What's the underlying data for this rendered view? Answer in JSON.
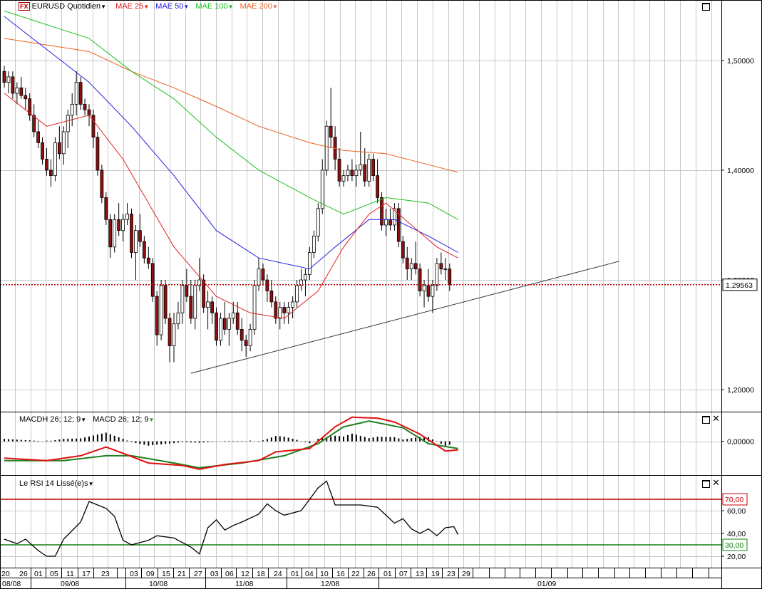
{
  "main_panel": {
    "symbol_badge": "FX",
    "instrument": "EURUSD Quotidien",
    "indicators": [
      {
        "label": "MAE 25",
        "color": "#e02020"
      },
      {
        "label": "MAE 50",
        "color": "#2020e0"
      },
      {
        "label": "MAE 100",
        "color": "#20c020"
      },
      {
        "label": "MAE 200",
        "color": "#f06020"
      }
    ],
    "price_ticks": [
      "1,50000",
      "1,40000",
      "1,30000",
      "1,20000"
    ],
    "current_price": "1,29563"
  },
  "macd_panel": {
    "labels": [
      {
        "label": "MACDH 26; 12; 9"
      },
      {
        "label": "MACD 26; 12; 9",
        "color": "#20a020"
      }
    ],
    "ticks": [
      "0,00000"
    ]
  },
  "rsi_panel": {
    "label": "Le RSI 14 Lissé(e)s",
    "ticks": [
      "60,00",
      "40,00",
      "20,00"
    ],
    "upper_level": "70,00",
    "lower_level": "30,00"
  },
  "date_axis": {
    "days": [
      "20",
      "26",
      "01",
      "05",
      "11",
      "17",
      "23",
      "03",
      "09",
      "15",
      "21",
      "27",
      "03",
      "06",
      "12",
      "18",
      "24",
      "01",
      "04",
      "10",
      "16",
      "22",
      "26",
      "01",
      "07",
      "13",
      "19",
      "23",
      "29"
    ],
    "months": [
      "08/08",
      "09/08",
      "10/08",
      "11/08",
      "12/08",
      "01/09"
    ]
  },
  "colors": {
    "up": "#ffffff",
    "down": "#8b1010",
    "grid": "#c8c8c8",
    "mae25": "#e02020",
    "mae50": "#2020e0",
    "mae100": "#20c020",
    "mae200": "#f06020",
    "macd_line": "#e01010",
    "signal_line": "#208020",
    "rsi_line": "#000000",
    "level_70": "#c00000",
    "level_30": "#108010"
  },
  "chart_data": {
    "type": "candlestick",
    "ylim": [
      1.18,
      1.555
    ],
    "current_price": 1.29563,
    "candles": [
      [
        1.49,
        1.495,
        1.475,
        1.48
      ],
      [
        1.48,
        1.49,
        1.47,
        1.485
      ],
      [
        1.485,
        1.49,
        1.465,
        1.47
      ],
      [
        1.47,
        1.48,
        1.46,
        1.475
      ],
      [
        1.475,
        1.485,
        1.465,
        1.468
      ],
      [
        1.468,
        1.475,
        1.455,
        1.465
      ],
      [
        1.465,
        1.47,
        1.445,
        1.45
      ],
      [
        1.45,
        1.46,
        1.43,
        1.435
      ],
      [
        1.435,
        1.445,
        1.42,
        1.425
      ],
      [
        1.425,
        1.43,
        1.405,
        1.41
      ],
      [
        1.41,
        1.42,
        1.395,
        1.4
      ],
      [
        1.4,
        1.41,
        1.385,
        1.395
      ],
      [
        1.395,
        1.43,
        1.39,
        1.425
      ],
      [
        1.425,
        1.44,
        1.41,
        1.415
      ],
      [
        1.415,
        1.44,
        1.405,
        1.435
      ],
      [
        1.435,
        1.455,
        1.42,
        1.45
      ],
      [
        1.45,
        1.47,
        1.44,
        1.46
      ],
      [
        1.46,
        1.49,
        1.45,
        1.48
      ],
      [
        1.48,
        1.485,
        1.455,
        1.46
      ],
      [
        1.46,
        1.465,
        1.45,
        1.455
      ],
      [
        1.455,
        1.46,
        1.44,
        1.45
      ],
      [
        1.45,
        1.455,
        1.42,
        1.43
      ],
      [
        1.43,
        1.435,
        1.395,
        1.4
      ],
      [
        1.4,
        1.405,
        1.37,
        1.375
      ],
      [
        1.375,
        1.38,
        1.35,
        1.355
      ],
      [
        1.355,
        1.36,
        1.32,
        1.33
      ],
      [
        1.33,
        1.36,
        1.325,
        1.355
      ],
      [
        1.355,
        1.37,
        1.34,
        1.345
      ],
      [
        1.345,
        1.36,
        1.335,
        1.355
      ],
      [
        1.355,
        1.37,
        1.35,
        1.36
      ],
      [
        1.36,
        1.365,
        1.32,
        1.325
      ],
      [
        1.325,
        1.35,
        1.3,
        1.345
      ],
      [
        1.345,
        1.36,
        1.33,
        1.335
      ],
      [
        1.335,
        1.34,
        1.315,
        1.32
      ],
      [
        1.32,
        1.33,
        1.31,
        1.315
      ],
      [
        1.315,
        1.32,
        1.28,
        1.285
      ],
      [
        1.285,
        1.29,
        1.24,
        1.25
      ],
      [
        1.25,
        1.3,
        1.245,
        1.295
      ],
      [
        1.295,
        1.3,
        1.26,
        1.265
      ],
      [
        1.265,
        1.27,
        1.225,
        1.24
      ],
      [
        1.24,
        1.27,
        1.225,
        1.26
      ],
      [
        1.26,
        1.28,
        1.255,
        1.27
      ],
      [
        1.27,
        1.3,
        1.26,
        1.295
      ],
      [
        1.295,
        1.31,
        1.28,
        1.285
      ],
      [
        1.285,
        1.3,
        1.26,
        1.265
      ],
      [
        1.265,
        1.3,
        1.255,
        1.295
      ],
      [
        1.295,
        1.32,
        1.29,
        1.3
      ],
      [
        1.3,
        1.305,
        1.27,
        1.275
      ],
      [
        1.275,
        1.29,
        1.255,
        1.28
      ],
      [
        1.28,
        1.285,
        1.26,
        1.27
      ],
      [
        1.27,
        1.275,
        1.24,
        1.245
      ],
      [
        1.245,
        1.27,
        1.24,
        1.265
      ],
      [
        1.265,
        1.28,
        1.25,
        1.255
      ],
      [
        1.255,
        1.27,
        1.24,
        1.265
      ],
      [
        1.265,
        1.28,
        1.26,
        1.27
      ],
      [
        1.27,
        1.28,
        1.25,
        1.255
      ],
      [
        1.255,
        1.265,
        1.235,
        1.245
      ],
      [
        1.245,
        1.25,
        1.23,
        1.24
      ],
      [
        1.24,
        1.26,
        1.235,
        1.255
      ],
      [
        1.255,
        1.3,
        1.25,
        1.295
      ],
      [
        1.295,
        1.32,
        1.29,
        1.31
      ],
      [
        1.31,
        1.315,
        1.295,
        1.3
      ],
      [
        1.3,
        1.305,
        1.28,
        1.29
      ],
      [
        1.29,
        1.3,
        1.275,
        1.28
      ],
      [
        1.28,
        1.285,
        1.26,
        1.265
      ],
      [
        1.265,
        1.28,
        1.255,
        1.275
      ],
      [
        1.275,
        1.28,
        1.26,
        1.27
      ],
      [
        1.27,
        1.28,
        1.26,
        1.275
      ],
      [
        1.275,
        1.285,
        1.265,
        1.28
      ],
      [
        1.28,
        1.3,
        1.275,
        1.295
      ],
      [
        1.295,
        1.31,
        1.29,
        1.3
      ],
      [
        1.3,
        1.31,
        1.285,
        1.305
      ],
      [
        1.305,
        1.33,
        1.3,
        1.325
      ],
      [
        1.325,
        1.345,
        1.32,
        1.34
      ],
      [
        1.34,
        1.37,
        1.335,
        1.365
      ],
      [
        1.365,
        1.41,
        1.36,
        1.4
      ],
      [
        1.4,
        1.445,
        1.395,
        1.44
      ],
      [
        1.44,
        1.475,
        1.42,
        1.43
      ],
      [
        1.43,
        1.44,
        1.4,
        1.41
      ],
      [
        1.41,
        1.42,
        1.385,
        1.39
      ],
      [
        1.39,
        1.4,
        1.385,
        1.395
      ],
      [
        1.395,
        1.405,
        1.39,
        1.4
      ],
      [
        1.4,
        1.41,
        1.39,
        1.395
      ],
      [
        1.395,
        1.405,
        1.385,
        1.4
      ],
      [
        1.4,
        1.435,
        1.395,
        1.405
      ],
      [
        1.405,
        1.42,
        1.385,
        1.39
      ],
      [
        1.39,
        1.415,
        1.385,
        1.41
      ],
      [
        1.41,
        1.415,
        1.39,
        1.395
      ],
      [
        1.395,
        1.41,
        1.37,
        1.375
      ],
      [
        1.375,
        1.38,
        1.345,
        1.35
      ],
      [
        1.35,
        1.365,
        1.34,
        1.355
      ],
      [
        1.355,
        1.365,
        1.345,
        1.35
      ],
      [
        1.35,
        1.37,
        1.345,
        1.365
      ],
      [
        1.365,
        1.37,
        1.33,
        1.335
      ],
      [
        1.335,
        1.34,
        1.315,
        1.32
      ],
      [
        1.32,
        1.33,
        1.3,
        1.31
      ],
      [
        1.31,
        1.32,
        1.3,
        1.315
      ],
      [
        1.315,
        1.335,
        1.305,
        1.31
      ],
      [
        1.31,
        1.315,
        1.285,
        1.29
      ],
      [
        1.29,
        1.3,
        1.275,
        1.295
      ],
      [
        1.295,
        1.31,
        1.28,
        1.285
      ],
      [
        1.285,
        1.3,
        1.27,
        1.295
      ],
      [
        1.295,
        1.32,
        1.29,
        1.315
      ],
      [
        1.315,
        1.325,
        1.305,
        1.31
      ],
      [
        1.31,
        1.32,
        1.3,
        1.31
      ],
      [
        1.31,
        1.315,
        1.29,
        1.2956
      ]
    ],
    "mae25": [
      [
        0,
        1.47
      ],
      [
        10,
        1.44
      ],
      [
        20,
        1.45
      ],
      [
        28,
        1.41
      ],
      [
        40,
        1.33
      ],
      [
        50,
        1.285
      ],
      [
        58,
        1.27
      ],
      [
        66,
        1.265
      ],
      [
        74,
        1.29
      ],
      [
        80,
        1.33
      ],
      [
        86,
        1.36
      ],
      [
        90,
        1.37
      ],
      [
        96,
        1.35
      ],
      [
        102,
        1.33
      ],
      [
        107,
        1.32
      ]
    ],
    "mae50": [
      [
        0,
        1.54
      ],
      [
        10,
        1.51
      ],
      [
        20,
        1.48
      ],
      [
        30,
        1.44
      ],
      [
        40,
        1.395
      ],
      [
        50,
        1.345
      ],
      [
        60,
        1.32
      ],
      [
        72,
        1.31
      ],
      [
        78,
        1.33
      ],
      [
        86,
        1.355
      ],
      [
        92,
        1.355
      ],
      [
        100,
        1.34
      ],
      [
        107,
        1.325
      ]
    ],
    "mae100": [
      [
        0,
        1.545
      ],
      [
        20,
        1.52
      ],
      [
        30,
        1.49
      ],
      [
        40,
        1.465
      ],
      [
        50,
        1.43
      ],
      [
        60,
        1.4
      ],
      [
        72,
        1.375
      ],
      [
        80,
        1.36
      ],
      [
        90,
        1.375
      ],
      [
        100,
        1.37
      ],
      [
        107,
        1.355
      ]
    ],
    "mae200": [
      [
        0,
        1.52
      ],
      [
        20,
        1.508
      ],
      [
        30,
        1.49
      ],
      [
        40,
        1.475
      ],
      [
        50,
        1.458
      ],
      [
        60,
        1.44
      ],
      [
        72,
        1.425
      ],
      [
        80,
        1.418
      ],
      [
        90,
        1.415
      ],
      [
        100,
        1.405
      ],
      [
        107,
        1.398
      ]
    ],
    "trendline": [
      [
        44,
        1.215
      ],
      [
        145,
        1.317
      ]
    ],
    "macd_ylim": [
      -0.07,
      0.06
    ],
    "macd_line": [
      [
        0,
        -0.035
      ],
      [
        10,
        -0.04
      ],
      [
        18,
        -0.03
      ],
      [
        24,
        -0.012
      ],
      [
        28,
        -0.025
      ],
      [
        34,
        -0.045
      ],
      [
        42,
        -0.05
      ],
      [
        46,
        -0.058
      ],
      [
        52,
        -0.048
      ],
      [
        60,
        -0.04
      ],
      [
        64,
        -0.022
      ],
      [
        72,
        -0.015
      ],
      [
        78,
        0.03
      ],
      [
        82,
        0.05
      ],
      [
        88,
        0.048
      ],
      [
        92,
        0.04
      ],
      [
        98,
        0.015
      ],
      [
        104,
        -0.02
      ],
      [
        107,
        -0.018
      ]
    ],
    "signal_line": [
      [
        0,
        -0.04
      ],
      [
        14,
        -0.04
      ],
      [
        24,
        -0.03
      ],
      [
        30,
        -0.03
      ],
      [
        40,
        -0.045
      ],
      [
        46,
        -0.055
      ],
      [
        56,
        -0.045
      ],
      [
        66,
        -0.03
      ],
      [
        74,
        -0.005
      ],
      [
        80,
        0.03
      ],
      [
        86,
        0.042
      ],
      [
        94,
        0.028
      ],
      [
        100,
        -0.005
      ],
      [
        107,
        -0.015
      ]
    ],
    "rsi_ylim": [
      10,
      90
    ],
    "rsi": [
      [
        0,
        35
      ],
      [
        3,
        31
      ],
      [
        5,
        35
      ],
      [
        8,
        25
      ],
      [
        10,
        20
      ],
      [
        12,
        20
      ],
      [
        14,
        35
      ],
      [
        18,
        50
      ],
      [
        20,
        68
      ],
      [
        24,
        62
      ],
      [
        26,
        55
      ],
      [
        28,
        34
      ],
      [
        30,
        30
      ],
      [
        34,
        34
      ],
      [
        36,
        38
      ],
      [
        40,
        36
      ],
      [
        44,
        28
      ],
      [
        46,
        22
      ],
      [
        48,
        45
      ],
      [
        50,
        52
      ],
      [
        52,
        43
      ],
      [
        54,
        47
      ],
      [
        56,
        50
      ],
      [
        60,
        57
      ],
      [
        62,
        66
      ],
      [
        64,
        60
      ],
      [
        66,
        56
      ],
      [
        70,
        60
      ],
      [
        72,
        70
      ],
      [
        74,
        80
      ],
      [
        76,
        86
      ],
      [
        78,
        65
      ],
      [
        84,
        65
      ],
      [
        88,
        63
      ],
      [
        90,
        56
      ],
      [
        92,
        49
      ],
      [
        94,
        53
      ],
      [
        96,
        44
      ],
      [
        98,
        40
      ],
      [
        100,
        44
      ],
      [
        102,
        38
      ],
      [
        104,
        45
      ],
      [
        106,
        46
      ],
      [
        107,
        39
      ]
    ],
    "rsi_levels": [
      70,
      30
    ]
  }
}
